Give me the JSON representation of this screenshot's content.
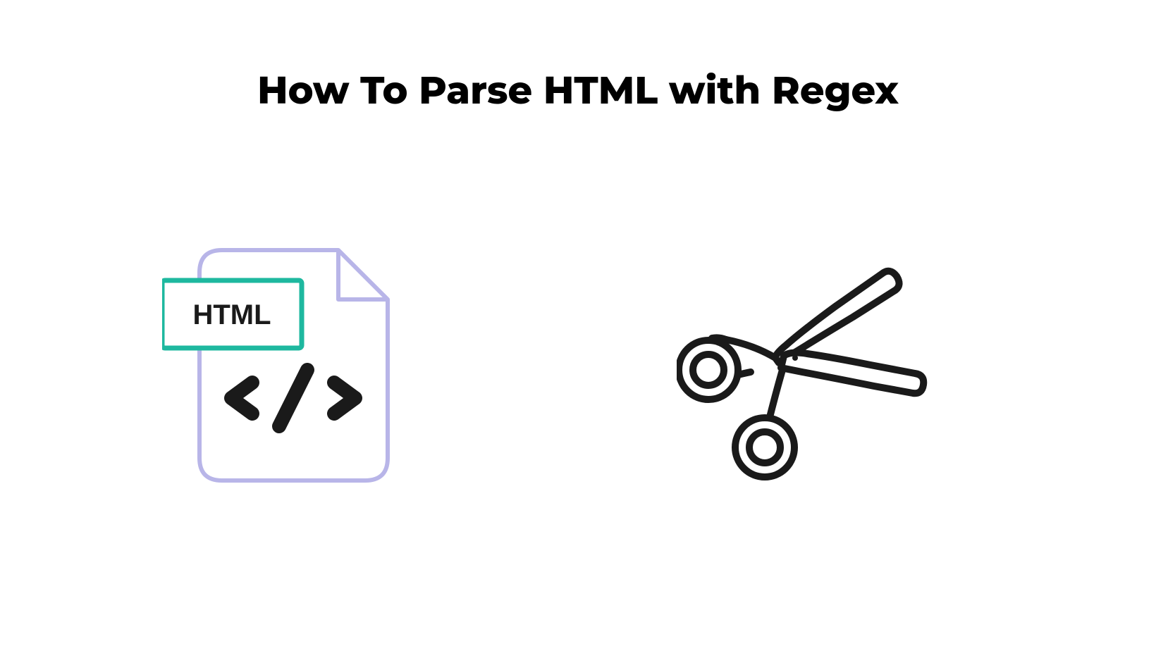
{
  "title": "How To Parse HTML with Regex",
  "htmlFileIcon": {
    "label": "HTML",
    "codeSymbol": "</>"
  },
  "colors": {
    "fileOutline": "#b8b5e8",
    "labelBorder": "#1eb89f",
    "iconStroke": "#1a1a1a"
  }
}
